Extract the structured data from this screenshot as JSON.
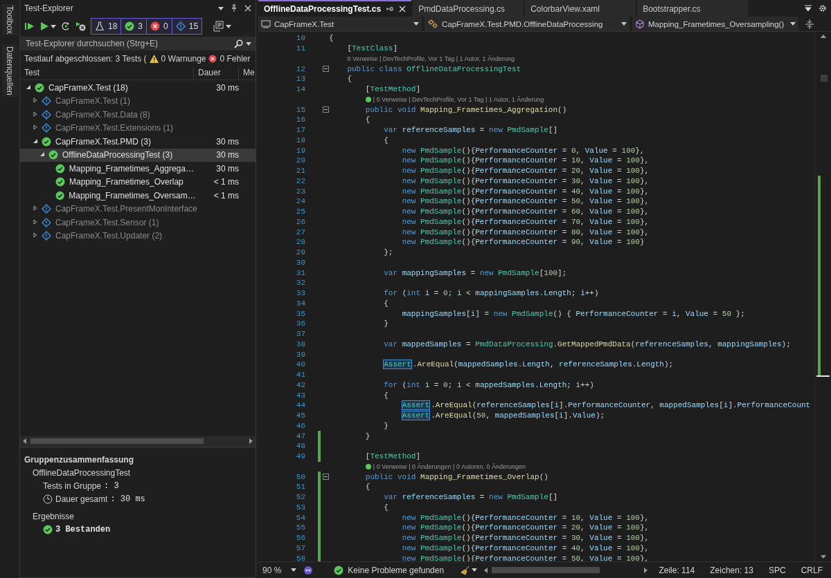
{
  "side_tabs": [
    "Toolbox",
    "Datenquellen"
  ],
  "test_explorer": {
    "title": "Test-Explorer",
    "filters": [
      {
        "kind": "total",
        "count": "18"
      },
      {
        "kind": "passed",
        "count": "3"
      },
      {
        "kind": "failed",
        "count": "0"
      },
      {
        "kind": "notrun",
        "count": "15"
      }
    ],
    "search": {
      "placeholder": "Test-Explorer durchsuchen (Strg+E)"
    },
    "run_status": {
      "text": "Testlauf abgeschlossen: 3 Tests (",
      "warnings": "0 Warnunge",
      "errors": "0 Fehler"
    },
    "columns": [
      "Test",
      "Dauer",
      "Me"
    ],
    "tree": [
      {
        "label": "CapFrameX.Test (18)",
        "kind": "passed",
        "expanded": true,
        "selected": false,
        "duration": "30 ms",
        "children": [
          {
            "label": "CapFrameX.Test (1)",
            "kind": "notrun",
            "expanded": false,
            "selected": false
          },
          {
            "label": "CapFrameX.Test.Data (8)",
            "kind": "notrun",
            "expanded": false,
            "selected": false
          },
          {
            "label": "CapFrameX.Test.Extensions (1)",
            "kind": "notrun",
            "expanded": false,
            "selected": false
          },
          {
            "label": "CapFrameX.Test.PMD (3)",
            "kind": "passed",
            "expanded": true,
            "selected": false,
            "duration": "30 ms",
            "children": [
              {
                "label": "OfflineDataProcessingTest (3)",
                "kind": "passed",
                "expanded": true,
                "selected": true,
                "duration": "30 ms",
                "children": [
                  {
                    "label": "Mapping_Frametimes_Aggrega…",
                    "kind": "passed",
                    "selected": false,
                    "duration": "30 ms"
                  },
                  {
                    "label": "Mapping_Frametimes_Overlap",
                    "kind": "passed",
                    "selected": false,
                    "duration": "< 1 ms"
                  },
                  {
                    "label": "Mapping_Frametimes_Oversam…",
                    "kind": "passed",
                    "selected": false,
                    "duration": "< 1 ms"
                  }
                ]
              }
            ]
          },
          {
            "label": "CapFrameX.Test.PresentMonInterface",
            "kind": "notrun",
            "expanded": false,
            "selected": false
          },
          {
            "label": "CapFrameX.Test.Sensor (1)",
            "kind": "notrun",
            "expanded": false,
            "selected": false
          },
          {
            "label": "CapFrameX.Test.Updater (2)",
            "kind": "notrun",
            "expanded": false,
            "selected": false
          }
        ]
      }
    ],
    "summary": {
      "title": "Gruppenzusammenfassung",
      "group": "OfflineDataProcessingTest",
      "stats": [
        {
          "kind": "count",
          "label": "Tests in Gruppe",
          "value": ": 3"
        },
        {
          "kind": "time",
          "label": "Dauer gesamt",
          "value": ": 30 ms"
        }
      ],
      "results_title": "Ergebnisse",
      "results": [
        {
          "kind": "passed",
          "text": "3 Bestanden"
        }
      ]
    }
  },
  "editor": {
    "tabs": [
      {
        "label": "OfflineDataProcessingTest.cs",
        "selected": true
      },
      {
        "label": "PmdDataProcessing.cs",
        "selected": false
      },
      {
        "label": "ColorbarView.xaml",
        "selected": false
      },
      {
        "label": "Bootstrapper.cs",
        "selected": false
      }
    ],
    "nav": [
      {
        "kind": "project",
        "label": "CapFrameX.Test"
      },
      {
        "kind": "class",
        "label": "CapFrameX.Test.PMD.OfflineDataProcessing"
      },
      {
        "kind": "method",
        "label": "Mapping_Frametimes_Oversampling()"
      }
    ],
    "rows": [
      {
        "kind": "code",
        "n": "10",
        "fold": false,
        "changed": false,
        "tokens": [
          {
            "kind": "p",
            "text": "{"
          }
        ]
      },
      {
        "kind": "code",
        "n": "11",
        "fold": false,
        "changed": false,
        "tokens": [
          {
            "kind": "p",
            "text": "    ["
          },
          {
            "kind": "type",
            "text": "TestClass"
          },
          {
            "kind": "p",
            "text": "]"
          }
        ]
      },
      {
        "kind": "lens",
        "passed": false,
        "pad": "    ",
        "text": "0 Verweise | DevTechProfile, Vor 1 Tag | 1 Autor, 1 Änderung"
      },
      {
        "kind": "code",
        "n": "12",
        "fold": true,
        "changed": false,
        "tokens": [
          {
            "kind": "kw",
            "text": "    public class "
          },
          {
            "kind": "type",
            "text": "OfflineDataProcessingTest"
          }
        ]
      },
      {
        "kind": "code",
        "n": "13",
        "fold": false,
        "changed": false,
        "tokens": [
          {
            "kind": "p",
            "text": "    {"
          }
        ]
      },
      {
        "kind": "code",
        "n": "14",
        "fold": false,
        "changed": false,
        "tokens": [
          {
            "kind": "p",
            "text": "        ["
          },
          {
            "kind": "type",
            "text": "TestMethod"
          },
          {
            "kind": "p",
            "text": "]"
          }
        ]
      },
      {
        "kind": "lens",
        "passed": true,
        "pad": "        ",
        "text": "| 0 Verweise | DevTechProfile, Vor 1 Tag | 1 Autor, 1 Änderung"
      },
      {
        "kind": "code",
        "n": "15",
        "fold": true,
        "changed": false,
        "tokens": [
          {
            "kind": "kw",
            "text": "        public void "
          },
          {
            "kind": "method",
            "text": "Mapping_Frametimes_Aggregation"
          },
          {
            "kind": "p",
            "text": "()"
          }
        ]
      },
      {
        "kind": "code",
        "n": "16",
        "fold": false,
        "changed": false,
        "tokens": [
          {
            "kind": "p",
            "text": "        {"
          }
        ]
      },
      {
        "kind": "code",
        "n": "17",
        "fold": false,
        "changed": false,
        "tokens": [
          {
            "kind": "kw",
            "text": "            var "
          },
          {
            "kind": "var",
            "text": "referenceSamples"
          },
          {
            "kind": "p",
            "text": " = "
          },
          {
            "kind": "kw",
            "text": "new "
          },
          {
            "kind": "type",
            "text": "PmdSample"
          },
          {
            "kind": "p",
            "text": "[]"
          }
        ]
      },
      {
        "kind": "code",
        "n": "18",
        "fold": false,
        "changed": false,
        "tokens": [
          {
            "kind": "p",
            "text": "            {"
          }
        ]
      },
      {
        "kind": "code",
        "n": "19",
        "fold": false,
        "changed": false,
        "tokens": [
          {
            "kind": "kw",
            "text": "                new "
          },
          {
            "kind": "type",
            "text": "PmdSample"
          },
          {
            "kind": "p",
            "text": "(){"
          },
          {
            "kind": "var",
            "text": "PerformanceCounter"
          },
          {
            "kind": "p",
            "text": " = "
          },
          {
            "kind": "num",
            "text": "0"
          },
          {
            "kind": "p",
            "text": ", "
          },
          {
            "kind": "var",
            "text": "Value"
          },
          {
            "kind": "p",
            "text": " = "
          },
          {
            "kind": "num",
            "text": "100"
          },
          {
            "kind": "p",
            "text": "},"
          }
        ]
      },
      {
        "kind": "code",
        "n": "20",
        "fold": false,
        "changed": false,
        "tokens": [
          {
            "kind": "kw",
            "text": "                new "
          },
          {
            "kind": "type",
            "text": "PmdSample"
          },
          {
            "kind": "p",
            "text": "(){"
          },
          {
            "kind": "var",
            "text": "PerformanceCounter"
          },
          {
            "kind": "p",
            "text": " = "
          },
          {
            "kind": "num",
            "text": "10"
          },
          {
            "kind": "p",
            "text": ", "
          },
          {
            "kind": "var",
            "text": "Value"
          },
          {
            "kind": "p",
            "text": " = "
          },
          {
            "kind": "num",
            "text": "100"
          },
          {
            "kind": "p",
            "text": "},"
          }
        ]
      },
      {
        "kind": "code",
        "n": "21",
        "fold": false,
        "changed": false,
        "tokens": [
          {
            "kind": "kw",
            "text": "                new "
          },
          {
            "kind": "type",
            "text": "PmdSample"
          },
          {
            "kind": "p",
            "text": "(){"
          },
          {
            "kind": "var",
            "text": "PerformanceCounter"
          },
          {
            "kind": "p",
            "text": " = "
          },
          {
            "kind": "num",
            "text": "20"
          },
          {
            "kind": "p",
            "text": ", "
          },
          {
            "kind": "var",
            "text": "Value"
          },
          {
            "kind": "p",
            "text": " = "
          },
          {
            "kind": "num",
            "text": "100"
          },
          {
            "kind": "p",
            "text": "},"
          }
        ]
      },
      {
        "kind": "code",
        "n": "22",
        "fold": false,
        "changed": false,
        "tokens": [
          {
            "kind": "kw",
            "text": "                new "
          },
          {
            "kind": "type",
            "text": "PmdSample"
          },
          {
            "kind": "p",
            "text": "(){"
          },
          {
            "kind": "var",
            "text": "PerformanceCounter"
          },
          {
            "kind": "p",
            "text": " = "
          },
          {
            "kind": "num",
            "text": "30"
          },
          {
            "kind": "p",
            "text": ", "
          },
          {
            "kind": "var",
            "text": "Value"
          },
          {
            "kind": "p",
            "text": " = "
          },
          {
            "kind": "num",
            "text": "100"
          },
          {
            "kind": "p",
            "text": "},"
          }
        ]
      },
      {
        "kind": "code",
        "n": "23",
        "fold": false,
        "changed": false,
        "tokens": [
          {
            "kind": "kw",
            "text": "                new "
          },
          {
            "kind": "type",
            "text": "PmdSample"
          },
          {
            "kind": "p",
            "text": "(){"
          },
          {
            "kind": "var",
            "text": "PerformanceCounter"
          },
          {
            "kind": "p",
            "text": " = "
          },
          {
            "kind": "num",
            "text": "40"
          },
          {
            "kind": "p",
            "text": ", "
          },
          {
            "kind": "var",
            "text": "Value"
          },
          {
            "kind": "p",
            "text": " = "
          },
          {
            "kind": "num",
            "text": "100"
          },
          {
            "kind": "p",
            "text": "},"
          }
        ]
      },
      {
        "kind": "code",
        "n": "24",
        "fold": false,
        "changed": false,
        "tokens": [
          {
            "kind": "kw",
            "text": "                new "
          },
          {
            "kind": "type",
            "text": "PmdSample"
          },
          {
            "kind": "p",
            "text": "(){"
          },
          {
            "kind": "var",
            "text": "PerformanceCounter"
          },
          {
            "kind": "p",
            "text": " = "
          },
          {
            "kind": "num",
            "text": "50"
          },
          {
            "kind": "p",
            "text": ", "
          },
          {
            "kind": "var",
            "text": "Value"
          },
          {
            "kind": "p",
            "text": " = "
          },
          {
            "kind": "num",
            "text": "100"
          },
          {
            "kind": "p",
            "text": "},"
          }
        ]
      },
      {
        "kind": "code",
        "n": "25",
        "fold": false,
        "changed": false,
        "tokens": [
          {
            "kind": "kw",
            "text": "                new "
          },
          {
            "kind": "type",
            "text": "PmdSample"
          },
          {
            "kind": "p",
            "text": "(){"
          },
          {
            "kind": "var",
            "text": "PerformanceCounter"
          },
          {
            "kind": "p",
            "text": " = "
          },
          {
            "kind": "num",
            "text": "60"
          },
          {
            "kind": "p",
            "text": ", "
          },
          {
            "kind": "var",
            "text": "Value"
          },
          {
            "kind": "p",
            "text": " = "
          },
          {
            "kind": "num",
            "text": "100"
          },
          {
            "kind": "p",
            "text": "},"
          }
        ]
      },
      {
        "kind": "code",
        "n": "26",
        "fold": false,
        "changed": false,
        "tokens": [
          {
            "kind": "kw",
            "text": "                new "
          },
          {
            "kind": "type",
            "text": "PmdSample"
          },
          {
            "kind": "p",
            "text": "(){"
          },
          {
            "kind": "var",
            "text": "PerformanceCounter"
          },
          {
            "kind": "p",
            "text": " = "
          },
          {
            "kind": "num",
            "text": "70"
          },
          {
            "kind": "p",
            "text": ", "
          },
          {
            "kind": "var",
            "text": "Value"
          },
          {
            "kind": "p",
            "text": " = "
          },
          {
            "kind": "num",
            "text": "100"
          },
          {
            "kind": "p",
            "text": "},"
          }
        ]
      },
      {
        "kind": "code",
        "n": "27",
        "fold": false,
        "changed": false,
        "tokens": [
          {
            "kind": "kw",
            "text": "                new "
          },
          {
            "kind": "type",
            "text": "PmdSample"
          },
          {
            "kind": "p",
            "text": "(){"
          },
          {
            "kind": "var",
            "text": "PerformanceCounter"
          },
          {
            "kind": "p",
            "text": " = "
          },
          {
            "kind": "num",
            "text": "80"
          },
          {
            "kind": "p",
            "text": ", "
          },
          {
            "kind": "var",
            "text": "Value"
          },
          {
            "kind": "p",
            "text": " = "
          },
          {
            "kind": "num",
            "text": "100"
          },
          {
            "kind": "p",
            "text": "},"
          }
        ]
      },
      {
        "kind": "code",
        "n": "28",
        "fold": false,
        "changed": false,
        "tokens": [
          {
            "kind": "kw",
            "text": "                new "
          },
          {
            "kind": "type",
            "text": "PmdSample"
          },
          {
            "kind": "p",
            "text": "(){"
          },
          {
            "kind": "var",
            "text": "PerformanceCounter"
          },
          {
            "kind": "p",
            "text": " = "
          },
          {
            "kind": "num",
            "text": "90"
          },
          {
            "kind": "p",
            "text": ", "
          },
          {
            "kind": "var",
            "text": "Value"
          },
          {
            "kind": "p",
            "text": " = "
          },
          {
            "kind": "num",
            "text": "100"
          },
          {
            "kind": "p",
            "text": "}"
          }
        ]
      },
      {
        "kind": "code",
        "n": "29",
        "fold": false,
        "changed": false,
        "tokens": [
          {
            "kind": "p",
            "text": "            };"
          }
        ]
      },
      {
        "kind": "code",
        "n": "30",
        "fold": false,
        "changed": false,
        "tokens": []
      },
      {
        "kind": "code",
        "n": "31",
        "fold": false,
        "changed": false,
        "tokens": [
          {
            "kind": "kw",
            "text": "            var "
          },
          {
            "kind": "var",
            "text": "mappingSamples"
          },
          {
            "kind": "p",
            "text": " = "
          },
          {
            "kind": "kw",
            "text": "new "
          },
          {
            "kind": "type",
            "text": "PmdSample"
          },
          {
            "kind": "p",
            "text": "["
          },
          {
            "kind": "num",
            "text": "100"
          },
          {
            "kind": "p",
            "text": "];"
          }
        ]
      },
      {
        "kind": "code",
        "n": "32",
        "fold": false,
        "changed": false,
        "tokens": []
      },
      {
        "kind": "code",
        "n": "33",
        "fold": false,
        "changed": false,
        "tokens": [
          {
            "kind": "kw",
            "text": "            for "
          },
          {
            "kind": "p",
            "text": "("
          },
          {
            "kind": "kw",
            "text": "int "
          },
          {
            "kind": "var",
            "text": "i"
          },
          {
            "kind": "p",
            "text": " = "
          },
          {
            "kind": "num",
            "text": "0"
          },
          {
            "kind": "p",
            "text": "; "
          },
          {
            "kind": "var",
            "text": "i"
          },
          {
            "kind": "p",
            "text": " < "
          },
          {
            "kind": "var",
            "text": "mappingSamples"
          },
          {
            "kind": "p",
            "text": "."
          },
          {
            "kind": "var",
            "text": "Length"
          },
          {
            "kind": "p",
            "text": "; "
          },
          {
            "kind": "var",
            "text": "i"
          },
          {
            "kind": "p",
            "text": "++)"
          }
        ]
      },
      {
        "kind": "code",
        "n": "34",
        "fold": false,
        "changed": false,
        "tokens": [
          {
            "kind": "p",
            "text": "            {"
          }
        ]
      },
      {
        "kind": "code",
        "n": "35",
        "fold": false,
        "changed": false,
        "tokens": [
          {
            "kind": "var",
            "text": "                mappingSamples"
          },
          {
            "kind": "p",
            "text": "["
          },
          {
            "kind": "var",
            "text": "i"
          },
          {
            "kind": "p",
            "text": "] = "
          },
          {
            "kind": "kw",
            "text": "new "
          },
          {
            "kind": "type",
            "text": "PmdSample"
          },
          {
            "kind": "p",
            "text": "() { "
          },
          {
            "kind": "var",
            "text": "PerformanceCounter"
          },
          {
            "kind": "p",
            "text": " = "
          },
          {
            "kind": "var",
            "text": "i"
          },
          {
            "kind": "p",
            "text": ", "
          },
          {
            "kind": "var",
            "text": "Value"
          },
          {
            "kind": "p",
            "text": " = "
          },
          {
            "kind": "num",
            "text": "50"
          },
          {
            "kind": "p",
            "text": " };"
          }
        ]
      },
      {
        "kind": "code",
        "n": "36",
        "fold": false,
        "changed": false,
        "tokens": [
          {
            "kind": "p",
            "text": "            }"
          }
        ]
      },
      {
        "kind": "code",
        "n": "37",
        "fold": false,
        "changed": false,
        "tokens": []
      },
      {
        "kind": "code",
        "n": "38",
        "fold": false,
        "changed": false,
        "tokens": [
          {
            "kind": "kw",
            "text": "            var "
          },
          {
            "kind": "var",
            "text": "mappedSamples"
          },
          {
            "kind": "p",
            "text": " = "
          },
          {
            "kind": "type",
            "text": "PmdDataProcessing"
          },
          {
            "kind": "p",
            "text": "."
          },
          {
            "kind": "method",
            "text": "GetMappedPmdData"
          },
          {
            "kind": "p",
            "text": "("
          },
          {
            "kind": "var",
            "text": "referenceSamples"
          },
          {
            "kind": "p",
            "text": ", "
          },
          {
            "kind": "var",
            "text": "mappingSamples"
          },
          {
            "kind": "p",
            "text": ");"
          }
        ]
      },
      {
        "kind": "code",
        "n": "39",
        "fold": false,
        "changed": false,
        "tokens": []
      },
      {
        "kind": "code",
        "n": "40",
        "fold": false,
        "changed": false,
        "tokens": [
          {
            "kind": "ref",
            "text": "            Assert"
          },
          {
            "kind": "p",
            "text": "."
          },
          {
            "kind": "method",
            "text": "AreEqual"
          },
          {
            "kind": "p",
            "text": "("
          },
          {
            "kind": "var",
            "text": "mappedSamples"
          },
          {
            "kind": "p",
            "text": "."
          },
          {
            "kind": "var",
            "text": "Length"
          },
          {
            "kind": "p",
            "text": ", "
          },
          {
            "kind": "var",
            "text": "referenceSamples"
          },
          {
            "kind": "p",
            "text": "."
          },
          {
            "kind": "var",
            "text": "Length"
          },
          {
            "kind": "p",
            "text": ");"
          }
        ]
      },
      {
        "kind": "code",
        "n": "41",
        "fold": false,
        "changed": false,
        "tokens": []
      },
      {
        "kind": "code",
        "n": "42",
        "fold": false,
        "changed": false,
        "tokens": [
          {
            "kind": "kw",
            "text": "            for "
          },
          {
            "kind": "p",
            "text": "("
          },
          {
            "kind": "kw",
            "text": "int "
          },
          {
            "kind": "var",
            "text": "i"
          },
          {
            "kind": "p",
            "text": " = "
          },
          {
            "kind": "num",
            "text": "0"
          },
          {
            "kind": "p",
            "text": "; "
          },
          {
            "kind": "var",
            "text": "i"
          },
          {
            "kind": "p",
            "text": " < "
          },
          {
            "kind": "var",
            "text": "mappedSamples"
          },
          {
            "kind": "p",
            "text": "."
          },
          {
            "kind": "var",
            "text": "Length"
          },
          {
            "kind": "p",
            "text": "; "
          },
          {
            "kind": "var",
            "text": "i"
          },
          {
            "kind": "p",
            "text": "++)"
          }
        ]
      },
      {
        "kind": "code",
        "n": "43",
        "fold": false,
        "changed": false,
        "tokens": [
          {
            "kind": "p",
            "text": "            {"
          }
        ]
      },
      {
        "kind": "code",
        "n": "44",
        "fold": false,
        "changed": false,
        "tokens": [
          {
            "kind": "ref",
            "text": "                Assert"
          },
          {
            "kind": "p",
            "text": "."
          },
          {
            "kind": "method",
            "text": "AreEqual"
          },
          {
            "kind": "p",
            "text": "("
          },
          {
            "kind": "var",
            "text": "referenceSamples"
          },
          {
            "kind": "p",
            "text": "["
          },
          {
            "kind": "var",
            "text": "i"
          },
          {
            "kind": "p",
            "text": "]."
          },
          {
            "kind": "var",
            "text": "PerformanceCounter"
          },
          {
            "kind": "p",
            "text": ", "
          },
          {
            "kind": "var",
            "text": "mappedSamples"
          },
          {
            "kind": "p",
            "text": "["
          },
          {
            "kind": "var",
            "text": "i"
          },
          {
            "kind": "p",
            "text": "]."
          },
          {
            "kind": "var",
            "text": "PerformanceCount"
          }
        ]
      },
      {
        "kind": "code",
        "n": "45",
        "fold": false,
        "changed": false,
        "tokens": [
          {
            "kind": "ref",
            "text": "                Assert"
          },
          {
            "kind": "p",
            "text": "."
          },
          {
            "kind": "method",
            "text": "AreEqual"
          },
          {
            "kind": "p",
            "text": "("
          },
          {
            "kind": "num",
            "text": "50"
          },
          {
            "kind": "p",
            "text": ", "
          },
          {
            "kind": "var",
            "text": "mappedSamples"
          },
          {
            "kind": "p",
            "text": "["
          },
          {
            "kind": "var",
            "text": "i"
          },
          {
            "kind": "p",
            "text": "]."
          },
          {
            "kind": "var",
            "text": "Value"
          },
          {
            "kind": "p",
            "text": ");"
          }
        ]
      },
      {
        "kind": "code",
        "n": "46",
        "fold": false,
        "changed": false,
        "tokens": [
          {
            "kind": "p",
            "text": "            }"
          }
        ]
      },
      {
        "kind": "code",
        "n": "47",
        "fold": false,
        "changed": true,
        "tokens": [
          {
            "kind": "p",
            "text": "        }"
          }
        ]
      },
      {
        "kind": "code",
        "n": "48",
        "fold": false,
        "changed": true,
        "tokens": []
      },
      {
        "kind": "code",
        "n": "49",
        "fold": false,
        "changed": true,
        "tokens": [
          {
            "kind": "p",
            "text": "        ["
          },
          {
            "kind": "type",
            "text": "TestMethod"
          },
          {
            "kind": "p",
            "text": "]"
          }
        ]
      },
      {
        "kind": "lens",
        "passed": true,
        "pad": "        ",
        "text": "| 0 Verweise | 0 Änderungen | 0 Autoren, 0 Änderungen"
      },
      {
        "kind": "code",
        "n": "50",
        "fold": true,
        "changed": true,
        "tokens": [
          {
            "kind": "kw",
            "text": "        public void "
          },
          {
            "kind": "method",
            "text": "Mapping_Frametimes_Overlap"
          },
          {
            "kind": "p",
            "text": "()"
          }
        ]
      },
      {
        "kind": "code",
        "n": "51",
        "fold": false,
        "changed": true,
        "tokens": [
          {
            "kind": "p",
            "text": "        {"
          }
        ]
      },
      {
        "kind": "code",
        "n": "52",
        "fold": false,
        "changed": true,
        "tokens": [
          {
            "kind": "kw",
            "text": "            var "
          },
          {
            "kind": "var",
            "text": "referenceSamples"
          },
          {
            "kind": "p",
            "text": " = "
          },
          {
            "kind": "kw",
            "text": "new "
          },
          {
            "kind": "type",
            "text": "PmdSample"
          },
          {
            "kind": "p",
            "text": "[]"
          }
        ]
      },
      {
        "kind": "code",
        "n": "53",
        "fold": false,
        "changed": true,
        "tokens": [
          {
            "kind": "p",
            "text": "            {"
          }
        ]
      },
      {
        "kind": "code",
        "n": "54",
        "fold": false,
        "changed": true,
        "tokens": [
          {
            "kind": "kw",
            "text": "                new "
          },
          {
            "kind": "type",
            "text": "PmdSample"
          },
          {
            "kind": "p",
            "text": "(){"
          },
          {
            "kind": "var",
            "text": "PerformanceCounter"
          },
          {
            "kind": "p",
            "text": " = "
          },
          {
            "kind": "num",
            "text": "10"
          },
          {
            "kind": "p",
            "text": ", "
          },
          {
            "kind": "var",
            "text": "Value"
          },
          {
            "kind": "p",
            "text": " = "
          },
          {
            "kind": "num",
            "text": "100"
          },
          {
            "kind": "p",
            "text": "},"
          }
        ]
      },
      {
        "kind": "code",
        "n": "55",
        "fold": false,
        "changed": true,
        "tokens": [
          {
            "kind": "kw",
            "text": "                new "
          },
          {
            "kind": "type",
            "text": "PmdSample"
          },
          {
            "kind": "p",
            "text": "(){"
          },
          {
            "kind": "var",
            "text": "PerformanceCounter"
          },
          {
            "kind": "p",
            "text": " = "
          },
          {
            "kind": "num",
            "text": "20"
          },
          {
            "kind": "p",
            "text": ", "
          },
          {
            "kind": "var",
            "text": "Value"
          },
          {
            "kind": "p",
            "text": " = "
          },
          {
            "kind": "num",
            "text": "100"
          },
          {
            "kind": "p",
            "text": "},"
          }
        ]
      },
      {
        "kind": "code",
        "n": "56",
        "fold": false,
        "changed": true,
        "tokens": [
          {
            "kind": "kw",
            "text": "                new "
          },
          {
            "kind": "type",
            "text": "PmdSample"
          },
          {
            "kind": "p",
            "text": "(){"
          },
          {
            "kind": "var",
            "text": "PerformanceCounter"
          },
          {
            "kind": "p",
            "text": " = "
          },
          {
            "kind": "num",
            "text": "30"
          },
          {
            "kind": "p",
            "text": ", "
          },
          {
            "kind": "var",
            "text": "Value"
          },
          {
            "kind": "p",
            "text": " = "
          },
          {
            "kind": "num",
            "text": "100"
          },
          {
            "kind": "p",
            "text": "},"
          }
        ]
      },
      {
        "kind": "code",
        "n": "57",
        "fold": false,
        "changed": true,
        "tokens": [
          {
            "kind": "kw",
            "text": "                new "
          },
          {
            "kind": "type",
            "text": "PmdSample"
          },
          {
            "kind": "p",
            "text": "(){"
          },
          {
            "kind": "var",
            "text": "PerformanceCounter"
          },
          {
            "kind": "p",
            "text": " = "
          },
          {
            "kind": "num",
            "text": "40"
          },
          {
            "kind": "p",
            "text": ", "
          },
          {
            "kind": "var",
            "text": "Value"
          },
          {
            "kind": "p",
            "text": " = "
          },
          {
            "kind": "num",
            "text": "100"
          },
          {
            "kind": "p",
            "text": "},"
          }
        ]
      },
      {
        "kind": "code",
        "n": "58",
        "fold": false,
        "changed": true,
        "tokens": [
          {
            "kind": "kw",
            "text": "                new "
          },
          {
            "kind": "type",
            "text": "PmdSample"
          },
          {
            "kind": "p",
            "text": "(){"
          },
          {
            "kind": "var",
            "text": "PerformanceCounter"
          },
          {
            "kind": "p",
            "text": " = "
          },
          {
            "kind": "num",
            "text": "50"
          },
          {
            "kind": "p",
            "text": ", "
          },
          {
            "kind": "var",
            "text": "Value"
          },
          {
            "kind": "p",
            "text": " = "
          },
          {
            "kind": "num",
            "text": "100"
          },
          {
            "kind": "p",
            "text": "},"
          }
        ]
      }
    ],
    "status_bar": {
      "zoom": "90 %",
      "issues": "Keine Probleme gefunden",
      "line": "Zeile: 114",
      "column": "Zeichen: 13",
      "whitespace": "SPC",
      "line_endings": "CRLF"
    }
  }
}
